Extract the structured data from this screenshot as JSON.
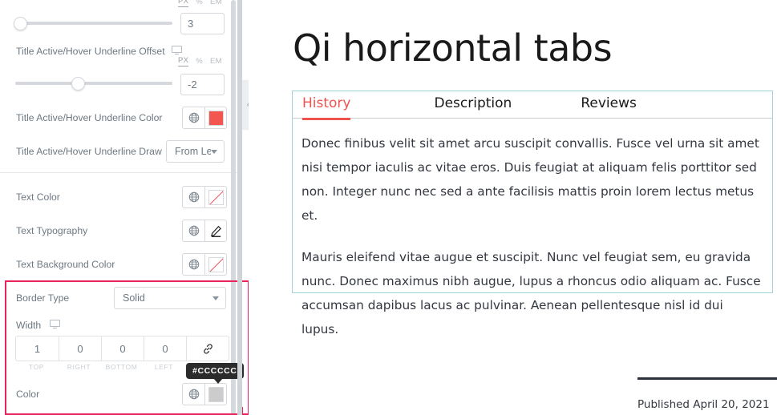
{
  "panel": {
    "underline_width": {
      "units": [
        "PX",
        "%",
        "EM"
      ],
      "active_unit": "PX",
      "value": "3"
    },
    "underline_offset": {
      "label": "Title Active/Hover Underline Offset",
      "units": [
        "PX",
        "%",
        "EM"
      ],
      "active_unit": "PX",
      "value": "-2"
    },
    "underline_color": {
      "label": "Title Active/Hover Underline Color",
      "swatch": "#F2564E"
    },
    "underline_draw": {
      "label": "Title Active/Hover Underline Draw",
      "value": "From Left"
    },
    "text_color": {
      "label": "Text Color"
    },
    "text_typography": {
      "label": "Text Typography"
    },
    "text_background_color": {
      "label": "Text Background Color"
    },
    "border_type": {
      "label": "Border Type",
      "value": "Solid"
    },
    "width": {
      "label": "Width",
      "values": [
        "1",
        "0",
        "0",
        "0"
      ],
      "labels": [
        "TOP",
        "RIGHT",
        "BOTTOM",
        "LEFT"
      ],
      "link_icon": "link-icon"
    },
    "color": {
      "label": "Color",
      "tooltip": "#CCCCCC",
      "swatch": "#CCCCCC"
    },
    "collapse_handle": "‹",
    "highlight_color": "#E8245C"
  },
  "content": {
    "title": "Qi horizontal tabs",
    "tabs": [
      {
        "label": "History",
        "active": true
      },
      {
        "label": "Description",
        "active": false
      },
      {
        "label": "Reviews",
        "active": false
      }
    ],
    "paragraphs": [
      "Donec finibus velit sit amet arcu suscipit convallis. Fusce vel urna sit amet nisi tempor iaculis ac vitae eros. Duis feugiat at aliquam felis porttitor sed non. Integer nunc nec sed a ante facilisis mattis proin lorem lectus metus et.",
      "Mauris eleifend vitae augue et suscipit. Nunc vel feugiat sem, eu gravida nunc. Donec maximus nibh augue, lupus a rhoncus odio aliquam ac. Fusce accumsan dapibus lacus ac pulvinar. Aenean pellentesque nisl id dui lupus."
    ],
    "published": "Published April 20, 2021",
    "tab_border_color": "#9ED2DE",
    "active_tab_color": "#EF5350"
  }
}
